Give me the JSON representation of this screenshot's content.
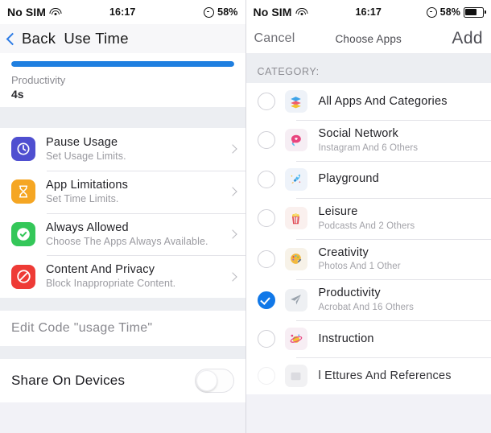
{
  "left": {
    "status": {
      "carrier": "No SIM",
      "wifi_icon": "wifi-icon",
      "time": "16:17",
      "alarm_icon": "alarm-icon",
      "battery": "58%"
    },
    "nav": {
      "back_label": "Back",
      "title": "Use Time",
      "back_icon": "chevron-left-icon"
    },
    "usage": {
      "progress_percent": 100,
      "category": "Productivity",
      "value": "4s"
    },
    "rows": [
      {
        "icon": "downtime-icon",
        "title": "Pause Usage",
        "subtitle": "Set Usage Limits.",
        "chevron": "chevron-right-icon"
      },
      {
        "icon": "hourglass-icon",
        "title": "App Limitations",
        "subtitle": "Set Time Limits.",
        "chevron": "chevron-right-icon"
      },
      {
        "icon": "check-badge-icon",
        "title": "Always Allowed",
        "subtitle": "Choose The Apps Always Available.",
        "chevron": "chevron-right-icon"
      },
      {
        "icon": "no-entry-icon",
        "title": "Content And Privacy",
        "subtitle": "Block Inappropriate Content.",
        "chevron": "chevron-right-icon"
      }
    ],
    "edit_code_label": "Edit Code \"usage Time\"",
    "share": {
      "label": "Share On Devices",
      "enabled": false
    }
  },
  "right": {
    "status": {
      "carrier": "No SIM",
      "wifi_icon": "wifi-icon",
      "time": "16:17",
      "alarm_icon": "alarm-icon",
      "battery": "58%"
    },
    "nav": {
      "cancel_label": "Cancel",
      "title": "Choose Apps",
      "add_label": "Add"
    },
    "section_header": "CATEGORY:",
    "categories": [
      {
        "icon": "layers-icon",
        "title": "All Apps And Categories",
        "subtitle": "",
        "selected": false
      },
      {
        "icon": "chat-heart-icon",
        "title": "Social Network",
        "subtitle": "Instagram And 6 Others",
        "selected": false
      },
      {
        "icon": "rocket-icon",
        "title": "Playground",
        "subtitle": "",
        "selected": false
      },
      {
        "icon": "popcorn-icon",
        "title": "Leisure",
        "subtitle": "Podcasts And 2 Others",
        "selected": false
      },
      {
        "icon": "palette-icon",
        "title": "Creativity",
        "subtitle": "Photos And 1 Other",
        "selected": false
      },
      {
        "icon": "paper-plane-icon",
        "title": "Productivity",
        "subtitle": "Acrobat And 16 Others",
        "selected": true
      },
      {
        "icon": "planet-icon",
        "title": "Instruction",
        "subtitle": "",
        "selected": false
      },
      {
        "icon": "book-icon",
        "title": "l Ettures And References",
        "subtitle": "",
        "selected": false
      }
    ]
  }
}
